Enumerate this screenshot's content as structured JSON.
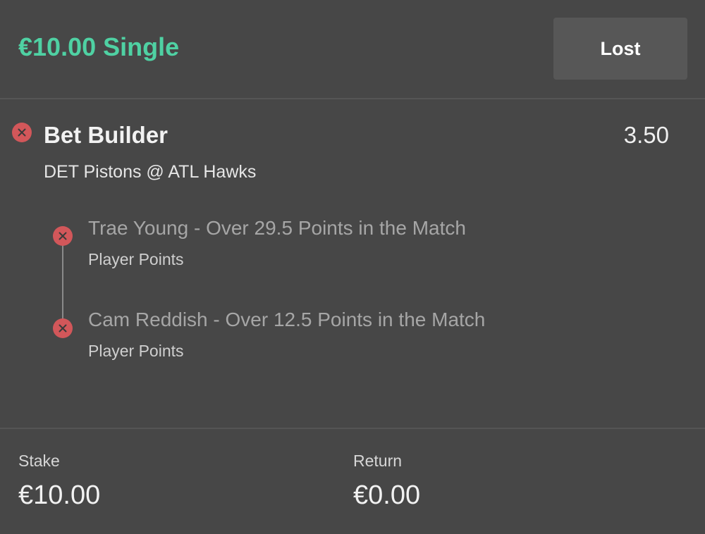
{
  "header": {
    "bet_title": "€10.00 Single",
    "status": "Lost"
  },
  "selection": {
    "title": "Bet Builder",
    "odds": "3.50",
    "event": "DET Pistons @ ATL Hawks",
    "result_icon": "x-circle-icon"
  },
  "legs": [
    {
      "selection": "Trae Young - Over 29.5 Points in the Match",
      "market": "Player Points",
      "result_icon": "x-circle-icon"
    },
    {
      "selection": "Cam Reddish - Over 12.5 Points in the Match",
      "market": "Player Points",
      "result_icon": "x-circle-icon"
    }
  ],
  "footer": {
    "stake_label": "Stake",
    "stake_value": "€10.00",
    "return_label": "Return",
    "return_value": "€0.00"
  },
  "colors": {
    "background": "#474747",
    "accent_green": "#4fd1a3",
    "lost_red": "#d2575a",
    "badge_background": "#575757"
  }
}
